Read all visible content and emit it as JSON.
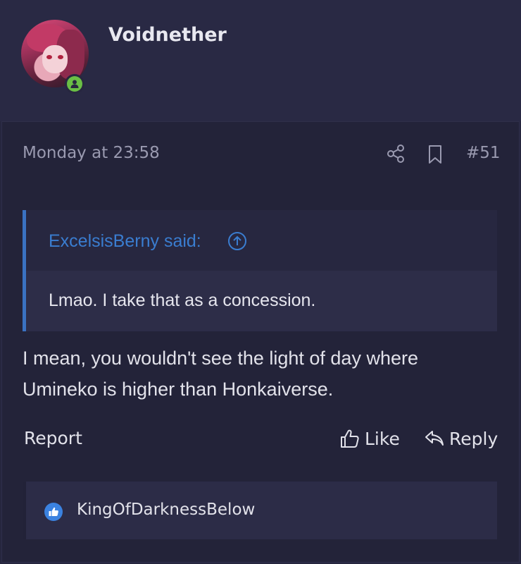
{
  "user": {
    "name": "Voidnether",
    "status": "online"
  },
  "post": {
    "timestamp": "Monday at 23:58",
    "number": "#51",
    "quote": {
      "author": "ExcelsisBerny said:",
      "text": "Lmao. I take that as a concession."
    },
    "message_line1": "I mean, you wouldn't see the light of day where",
    "message_line2": "Umineko is higher than Honkaiverse.",
    "actions": {
      "report": "Report",
      "like": "Like",
      "reply": "Reply"
    },
    "reactions": {
      "users": "KingOfDarknessBelow",
      "icon": "thumbs-up-icon"
    }
  },
  "colors": {
    "background": "#26263f",
    "accent_blue": "#3a7dd0",
    "online_green": "#6abf45"
  }
}
